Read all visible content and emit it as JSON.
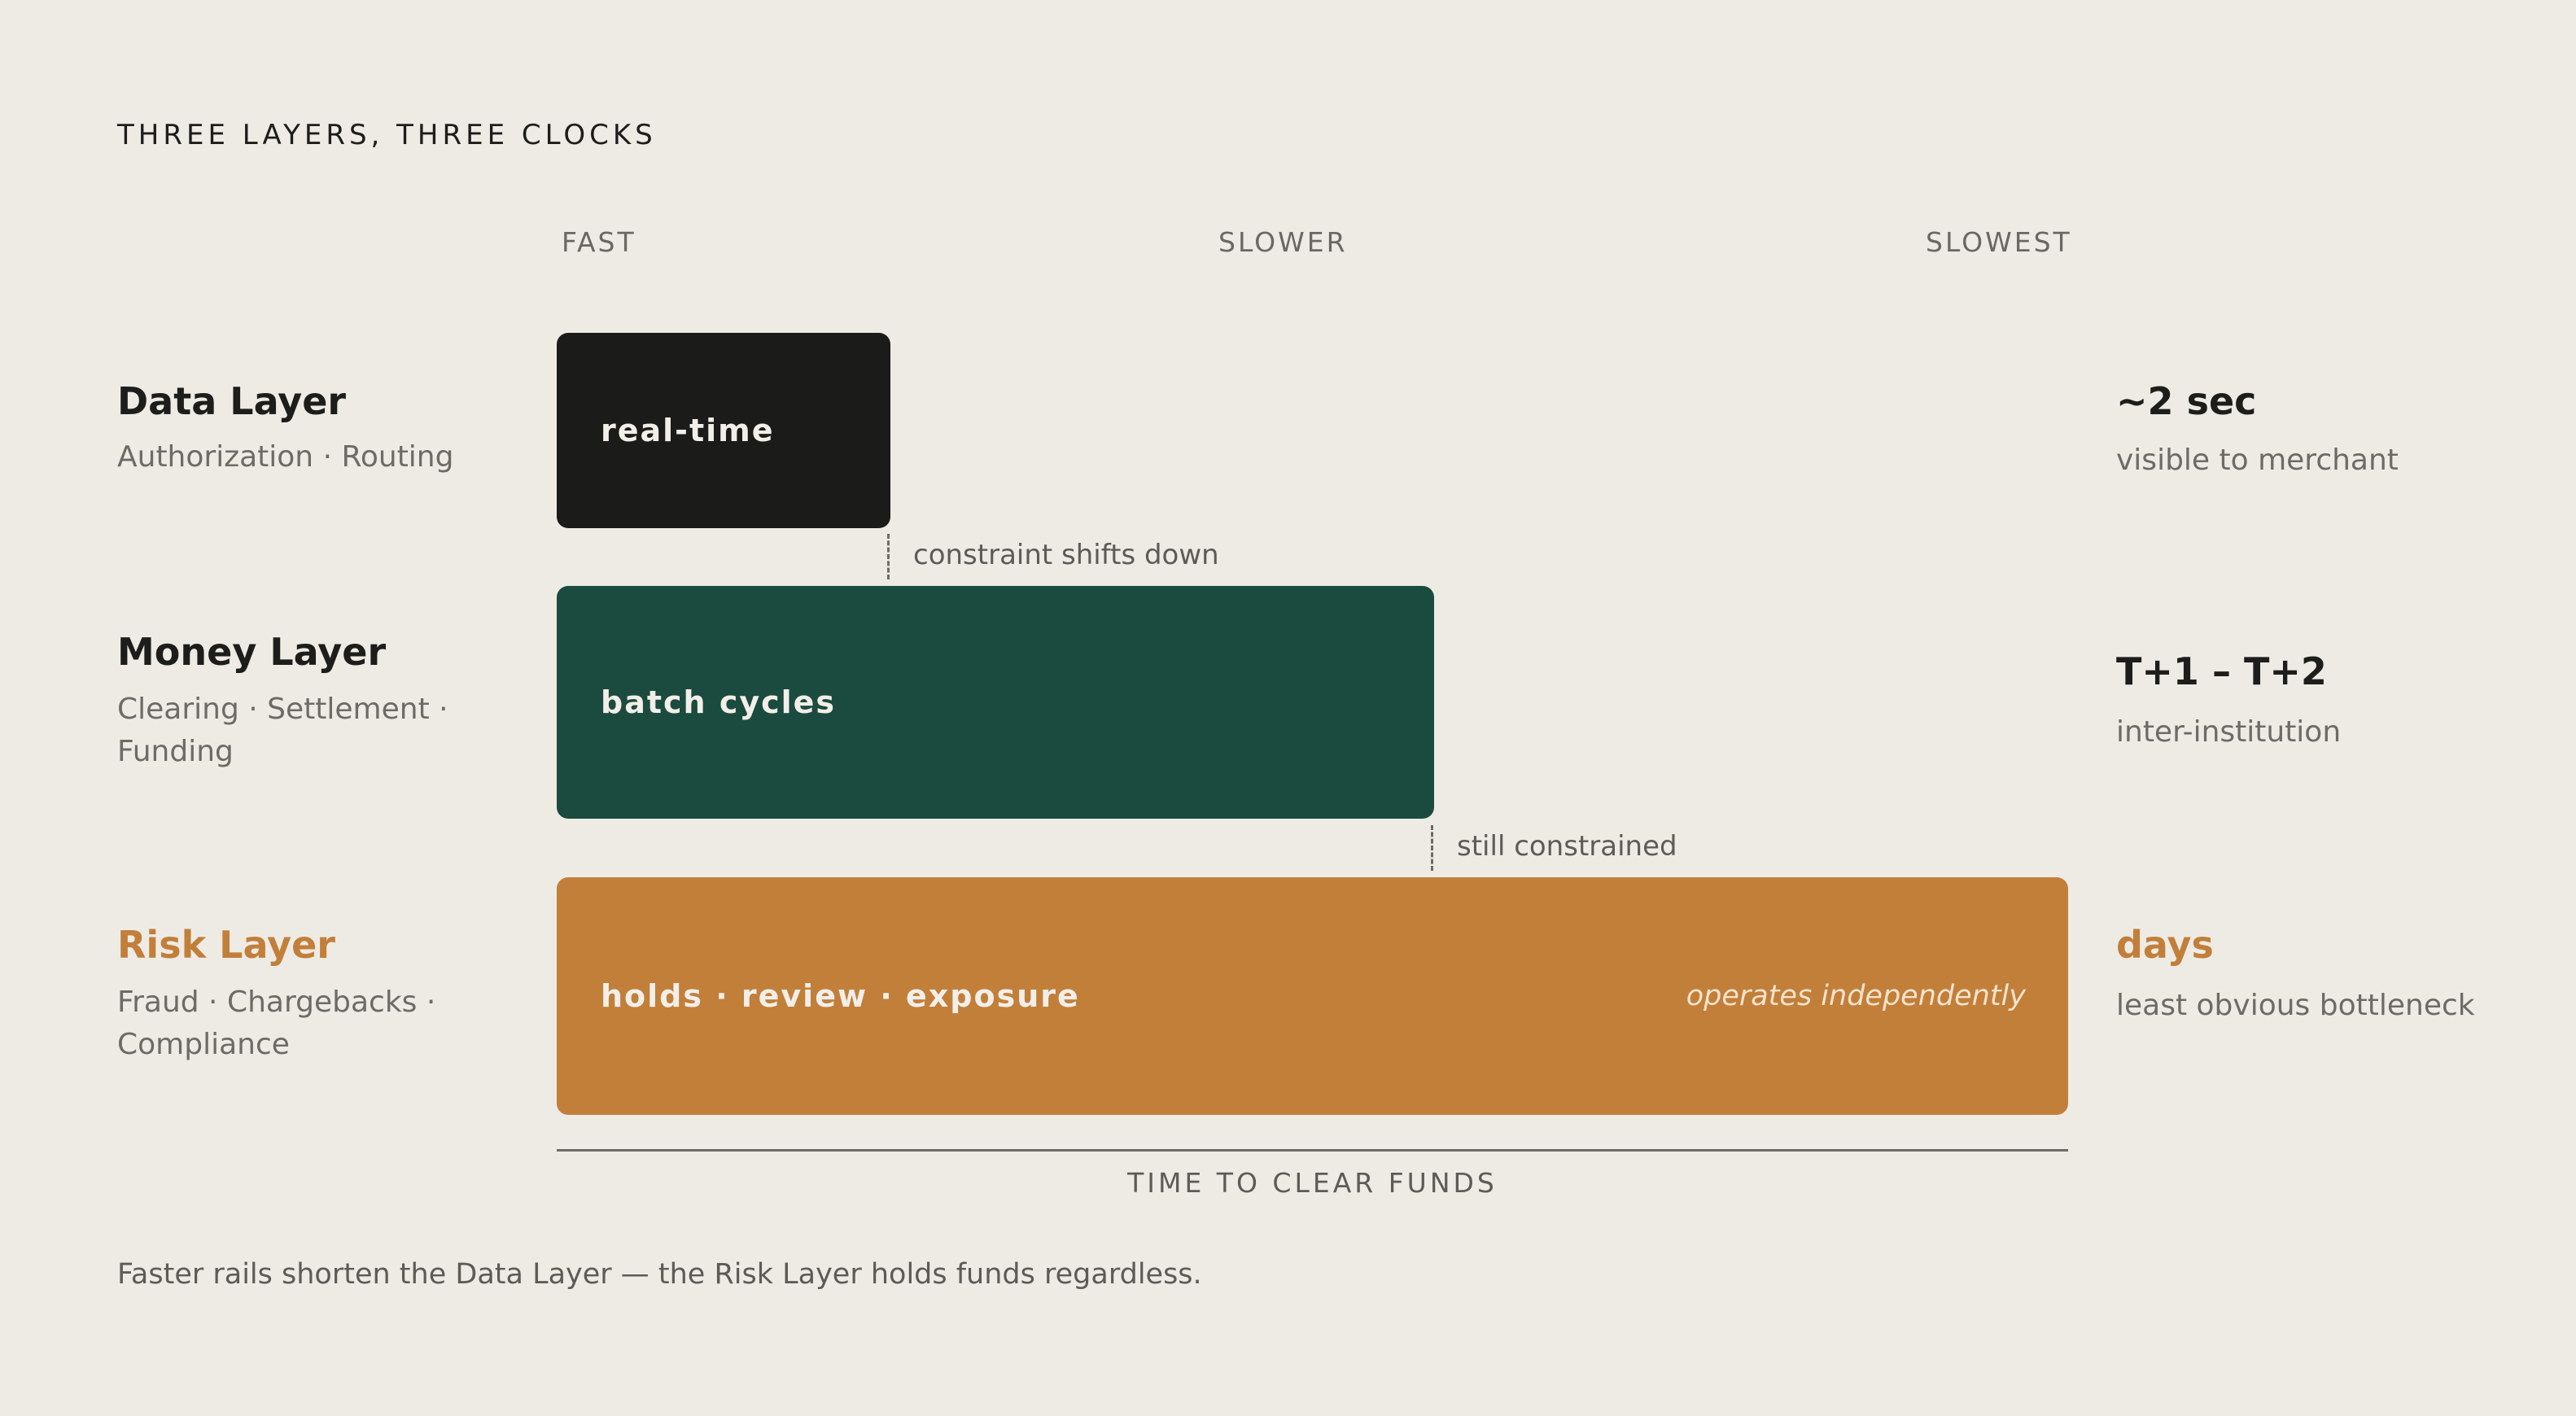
{
  "title": "THREE LAYERS, THREE CLOCKS",
  "scale_labels": {
    "fast": "FAST",
    "slower": "SLOWER",
    "slowest": "SLOWEST"
  },
  "layers": {
    "data": {
      "name": "Data Layer",
      "subtitle": "Authorization · Routing",
      "bar_label": "real-time",
      "metric": "~2 sec",
      "metric_sub": "visible to merchant",
      "color": "#1B1B19"
    },
    "money": {
      "name": "Money Layer",
      "subtitle": "Clearing · Settlement · Funding",
      "bar_label": "batch cycles",
      "metric": "T+1 – T+2",
      "metric_sub": "inter-institution",
      "color": "#1B4B3E"
    },
    "risk": {
      "name": "Risk Layer",
      "subtitle": "Fraud · Chargebacks · Compliance",
      "bar_label": "holds · review · exposure",
      "bar_note": "operates independently",
      "metric": "days",
      "metric_sub": "least obvious bottleneck",
      "color": "#C27F3A"
    }
  },
  "connectors": {
    "first": "constraint shifts down",
    "second": "still constrained"
  },
  "axis_label": "TIME TO CLEAR FUNDS",
  "footnote": "Faster rails shorten the Data Layer — the Risk Layer holds funds regardless."
}
